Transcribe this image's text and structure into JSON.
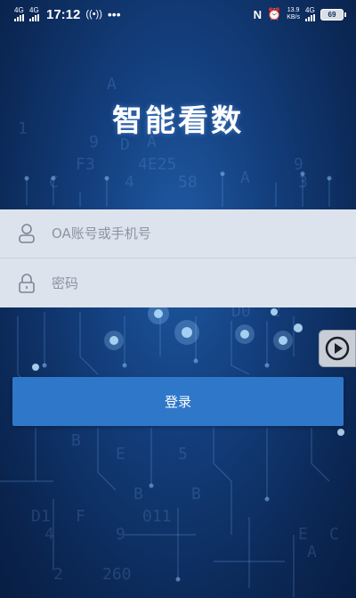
{
  "status_bar": {
    "network1": "4G",
    "network2": "4G",
    "time": "17:12",
    "speed_value": "13.9",
    "speed_unit": "KB/s",
    "network3": "4G",
    "battery": "69"
  },
  "app": {
    "title": "智能看数"
  },
  "login_form": {
    "account_placeholder": "OA账号或手机号",
    "password_placeholder": "密码",
    "account_value": "",
    "password_value": ""
  },
  "login_button": {
    "label": "登录"
  },
  "icons": {
    "account": "user-icon",
    "password": "lock-icon",
    "side": "play-icon"
  }
}
